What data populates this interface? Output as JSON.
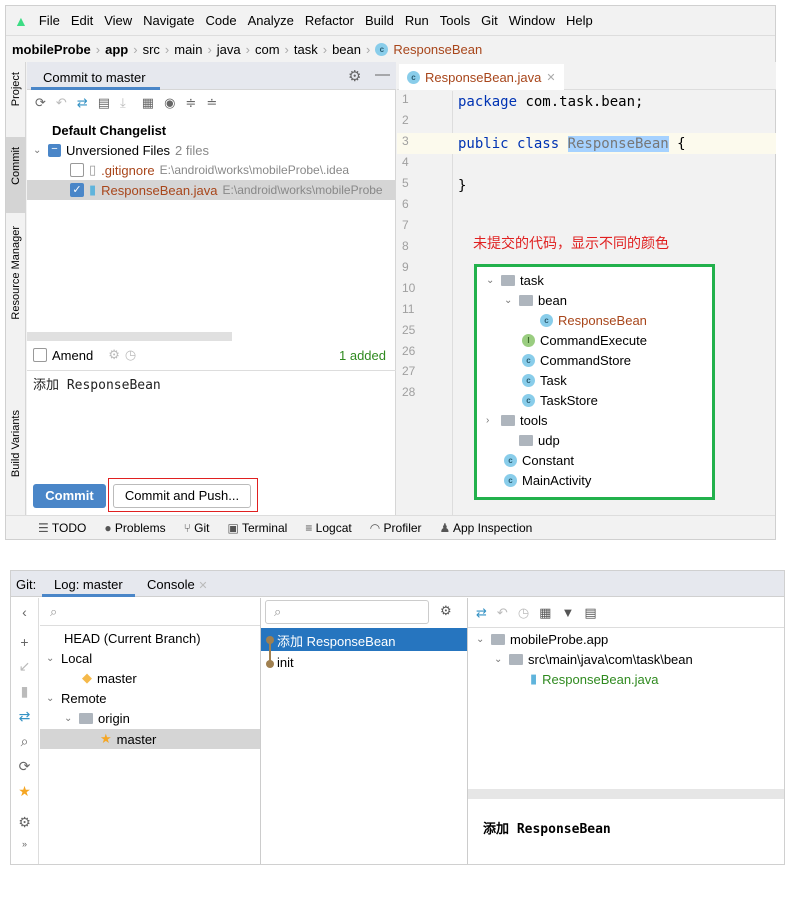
{
  "menu": [
    "File",
    "Edit",
    "View",
    "Navigate",
    "Code",
    "Analyze",
    "Refactor",
    "Build",
    "Run",
    "Tools",
    "Git",
    "Window",
    "Help"
  ],
  "breadcrumb": [
    "mobileProbe",
    "app",
    "src",
    "main",
    "java",
    "com",
    "task",
    "bean",
    "ResponseBean"
  ],
  "side_tabs": [
    "Project",
    "Commit",
    "Resource Manager",
    "Build Variants"
  ],
  "commit": {
    "title": "Commit to master",
    "changelist": "Default Changelist",
    "group": "Unversioned Files",
    "group_count": "2 files",
    "files": [
      {
        "name": ".gitignore",
        "path": "E:\\android\\works\\mobileProbe\\.idea",
        "checked": false
      },
      {
        "name": "ResponseBean.java",
        "path": "E:\\android\\works\\mobileProbe",
        "checked": true
      }
    ],
    "amend": "Amend",
    "added": "1 added",
    "message": "添加 ResponseBean",
    "commit_btn": "Commit",
    "commit_push_btn": "Commit and Push..."
  },
  "editor": {
    "tab": "ResponseBean.java",
    "lines": [
      "1",
      "2",
      "3",
      "4",
      "5",
      "6",
      "7",
      "8",
      "9",
      "10",
      "11",
      "25",
      "26",
      "27",
      "28"
    ],
    "code": {
      "l1_kw": "package",
      "l1_rest": " com.task.bean;",
      "l3_kw": "public class ",
      "l3_name": "ResponseBean",
      "l3_rest": " {",
      "l5": "}"
    },
    "annotation": "未提交的代码，显示不同的颜色",
    "tree": [
      {
        "label": "task",
        "type": "folder",
        "chev": "⌄"
      },
      {
        "label": "bean",
        "type": "folder",
        "chev": "⌄"
      },
      {
        "label": "ResponseBean",
        "type": "class",
        "modified": true
      },
      {
        "label": "CommandExecute",
        "type": "interface"
      },
      {
        "label": "CommandStore",
        "type": "class"
      },
      {
        "label": "Task",
        "type": "class"
      },
      {
        "label": "TaskStore",
        "type": "class"
      },
      {
        "label": "tools",
        "type": "folder",
        "chev": "›"
      },
      {
        "label": "udp",
        "type": "folder"
      },
      {
        "label": "Constant",
        "type": "class"
      },
      {
        "label": "MainActivity",
        "type": "class"
      }
    ]
  },
  "bottom_tools": [
    "TODO",
    "Problems",
    "Git",
    "Terminal",
    "Logcat",
    "Profiler",
    "App Inspection"
  ],
  "git": {
    "label": "Git:",
    "tabs": [
      "Log: master",
      "Console"
    ],
    "branches": {
      "head": "HEAD (Current Branch)",
      "local": "Local",
      "local_master": "master",
      "remote": "Remote",
      "origin": "origin",
      "remote_master": "master"
    },
    "commits": [
      "添加 ResponseBean",
      "init"
    ],
    "changes": {
      "module": "mobileProbe.app",
      "dir": "src\\main\\java\\com\\task\\bean",
      "file": "ResponseBean.java"
    },
    "detail_message": "添加 ResponseBean"
  },
  "colors": {
    "accent": "#4a86c8",
    "modified": "#a8461b",
    "added": "#2f8a1f",
    "annotation": "#e02020",
    "highlight_box": "#22b14c",
    "selection": "#2675bf"
  }
}
